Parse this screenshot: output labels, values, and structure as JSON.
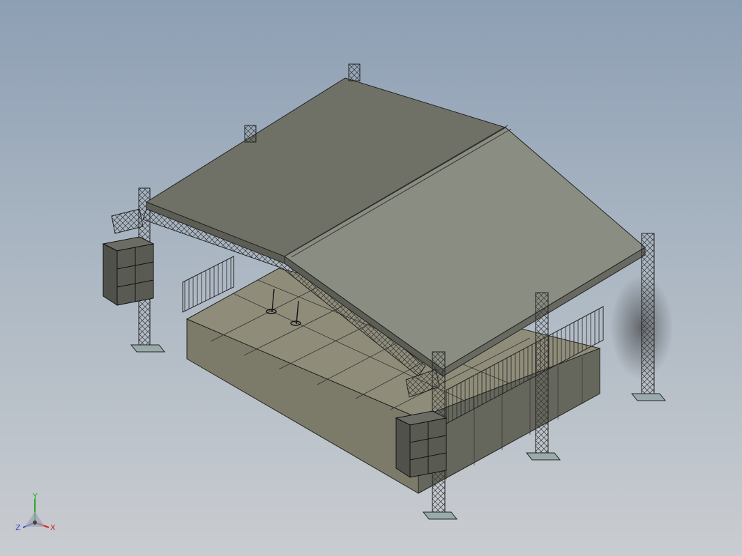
{
  "viewport": {
    "background_top": "#8d9fb4",
    "background_bottom": "#c9ccd0"
  },
  "model": {
    "roof_color_left": "#6f7166",
    "roof_color_right": "#8a8d82",
    "roof_edge_color": "#5c5e55",
    "stage_top_color": "#8f8d7a",
    "stage_side_color": "#7c7a69",
    "stage_front_color": "#66675c",
    "truss_color": "#5a5d60",
    "speaker_color": "#54564f"
  },
  "triad": {
    "x_label": "X",
    "y_label": "Y",
    "z_label": "Z",
    "x_color": "#d22020",
    "y_color": "#2aa52a",
    "z_color": "#2a3fd2"
  }
}
